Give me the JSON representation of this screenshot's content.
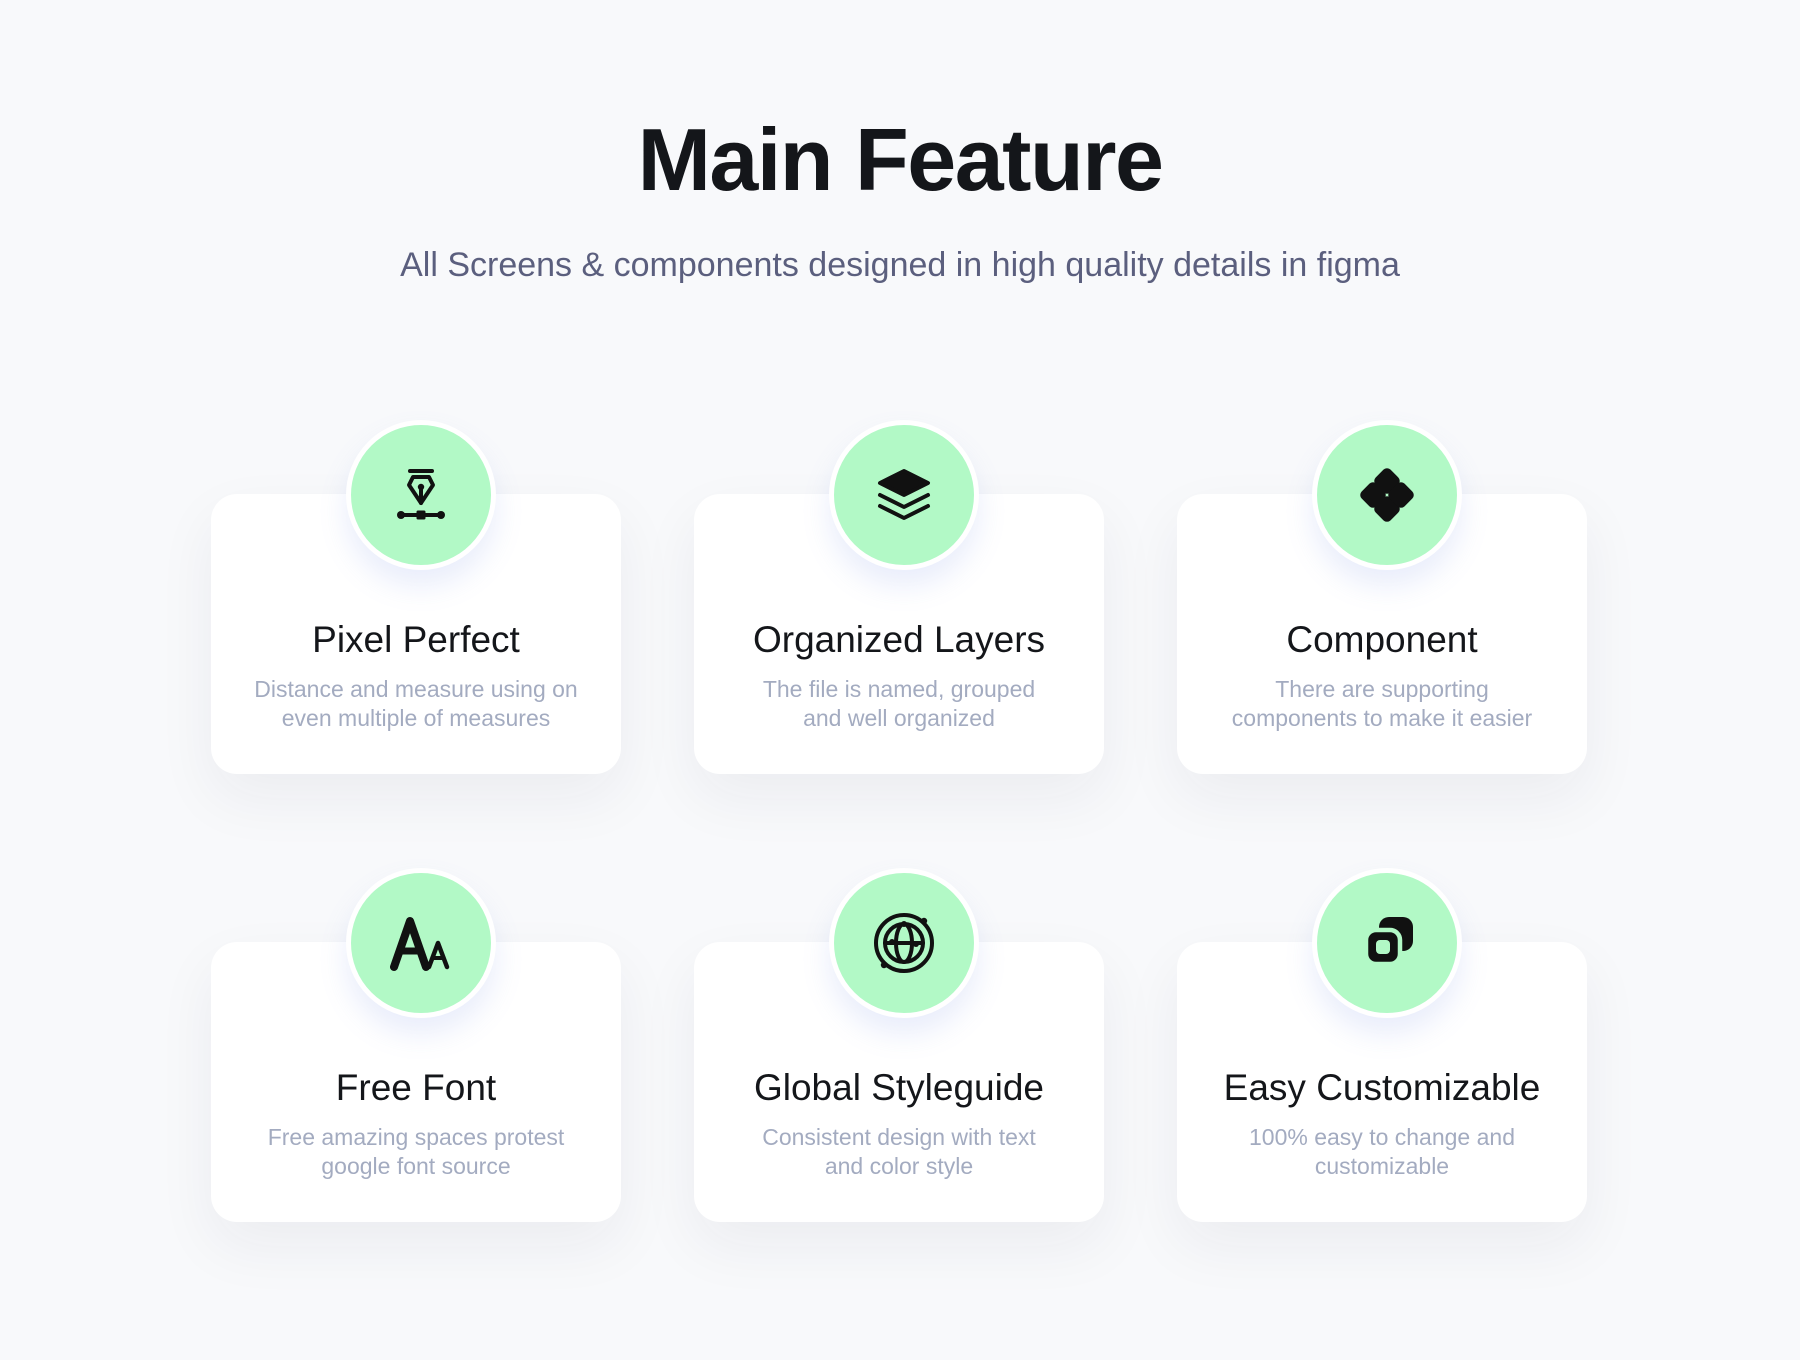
{
  "header": {
    "title": "Main Feature",
    "subtitle": "All Screens & components designed in high quality details in figma"
  },
  "colors": {
    "background": "#f8f9fb",
    "card": "#ffffff",
    "icon_circle": "#b2f9c6",
    "title": "#14161a",
    "subtitle": "#5b5f7e",
    "description": "#a3abc0"
  },
  "features": [
    {
      "icon": "pen-tool-icon",
      "title": "Pixel Perfect",
      "line1": "Distance and measure using on",
      "line2": "even multiple of measures"
    },
    {
      "icon": "layers-icon",
      "title": "Organized Layers",
      "line1": "The file is named, grouped",
      "line2": "and well organized"
    },
    {
      "icon": "component-icon",
      "title": "Component",
      "line1": "There are supporting",
      "line2": "components to make it easier"
    },
    {
      "icon": "font-icon",
      "title": "Free Font",
      "line1": "Free amazing spaces protest",
      "line2": "google font source"
    },
    {
      "icon": "globe-icon",
      "title": "Global Styleguide",
      "line1": "Consistent design with text",
      "line2": "and color style"
    },
    {
      "icon": "copy-icon",
      "title": "Easy Customizable",
      "line1": "100% easy to change and",
      "line2": "customizable"
    }
  ]
}
